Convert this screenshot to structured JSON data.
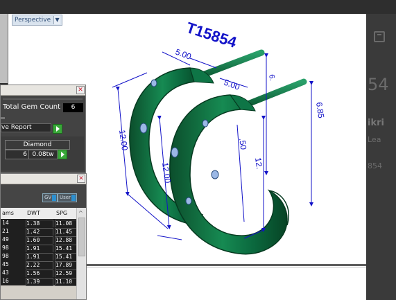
{
  "viewport": {
    "view_mode": "Perspective"
  },
  "model": {
    "label": "T15854",
    "dims": [
      "5.00",
      "5.00",
      "6.",
      "6.85",
      "12.00",
      "12.00",
      "12.",
      ".50"
    ]
  },
  "right_panel": {
    "big_text": "54",
    "name": "ikri",
    "sub": "Lea",
    "code": "854"
  },
  "gem_panel": {
    "total_label": "Total Gem Count",
    "total_value": "6",
    "report_label": "ve Report",
    "col_header": "Diamond",
    "count": "6",
    "weight": "0.08tw"
  },
  "table_panel": {
    "toggle_gv": "GV",
    "toggle_user": "User",
    "headers": [
      "ams",
      "DWT",
      "SPG"
    ],
    "rows": [
      [
        "14",
        "1.38",
        "11.08"
      ],
      [
        "21",
        "1.42",
        "11.45"
      ],
      [
        "49",
        "1.60",
        "12.88"
      ],
      [
        "98",
        "1.91",
        "15.41"
      ],
      [
        "98",
        "1.91",
        "15.41"
      ],
      [
        "45",
        "2.22",
        "17.89"
      ],
      [
        "43",
        "1.56",
        "12.59"
      ],
      [
        "16",
        "1.39",
        "11.10"
      ]
    ]
  },
  "colors": {
    "metal": "#0a6b3e",
    "dimension": "#1212c8",
    "accent_green": "#3aa83a"
  }
}
